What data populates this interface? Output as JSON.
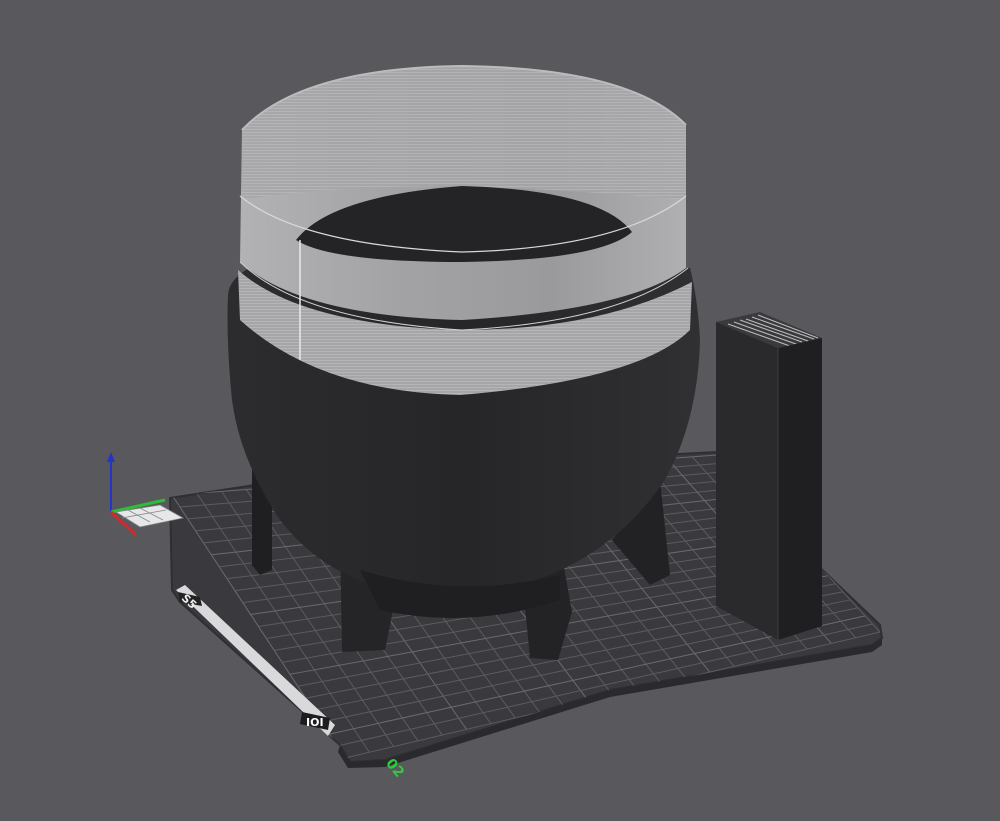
{
  "viewport": {
    "background": "#58585d"
  },
  "plate": {
    "number_label": "02",
    "number_color": "#2ecc40",
    "left_edge_label": "S5",
    "front_edge_label": "IOI",
    "surface_color": "#3a3a3e",
    "grid_color": "#5b5b60"
  },
  "axes": {
    "x_color": "#d12a2a",
    "y_color": "#2ebd3a",
    "z_color": "#2434c8"
  },
  "objects": [
    {
      "name": "pot-model",
      "upper_color": "#a9a9ab",
      "lower_color": "#2b2b2d"
    },
    {
      "name": "tower-model",
      "color": "#2b2b2d"
    }
  ]
}
